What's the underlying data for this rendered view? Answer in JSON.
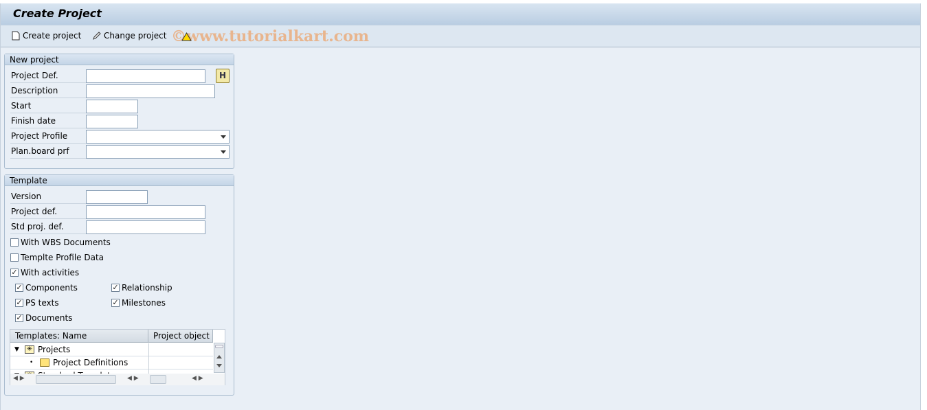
{
  "title": "Create Project",
  "toolbar": {
    "create_label": "Create project",
    "change_label": "Change project",
    "watermark": "©www.tutorialkart.com"
  },
  "new_project": {
    "header": "New project",
    "fields": [
      {
        "label": "Project Def.",
        "value": ""
      },
      {
        "label": "Description",
        "value": ""
      },
      {
        "label": "Start",
        "value": ""
      },
      {
        "label": "Finish date",
        "value": ""
      },
      {
        "label": "Project Profile",
        "value": ""
      },
      {
        "label": "Plan.board prf",
        "value": ""
      }
    ]
  },
  "template": {
    "header": "Template",
    "fields": [
      {
        "label": "Version",
        "value": ""
      },
      {
        "label": "Project def.",
        "value": ""
      },
      {
        "label": "Std proj. def.",
        "value": ""
      }
    ],
    "checkboxes": [
      {
        "label": "With WBS Documents",
        "checked": false
      },
      {
        "label": "Templte Profile Data",
        "checked": false
      },
      {
        "label": "With activities",
        "checked": true
      },
      {
        "label": "Components",
        "checked": true
      },
      {
        "label": "Relationship",
        "checked": true
      },
      {
        "label": "PS texts",
        "checked": true
      },
      {
        "label": "Milestones",
        "checked": true
      },
      {
        "label": "Documents",
        "checked": true
      }
    ],
    "tree": {
      "columns": [
        "Templates: Name",
        "Project object"
      ],
      "rows": [
        {
          "label": "Projects",
          "icon": "structure-icon"
        },
        {
          "label": "Project Definitions",
          "icon": "folder-icon"
        },
        {
          "label": "Standard Templates",
          "icon": "structure-icon"
        }
      ]
    }
  }
}
